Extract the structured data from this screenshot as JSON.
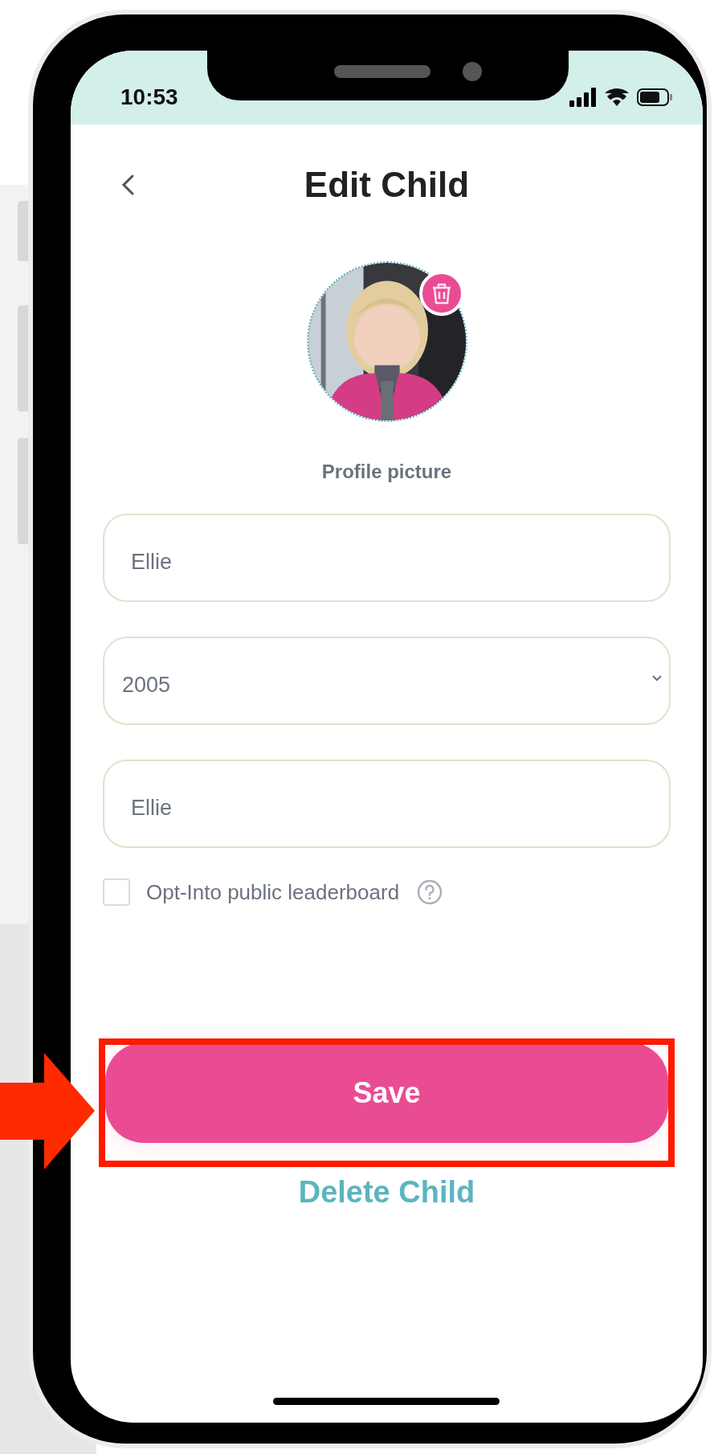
{
  "status_bar": {
    "time": "10:53"
  },
  "header": {
    "title": "Edit Child"
  },
  "profile": {
    "label": "Profile picture"
  },
  "fields": [
    {
      "kind": "text",
      "value": "Ellie"
    },
    {
      "kind": "select",
      "value": "2005"
    },
    {
      "kind": "text",
      "value": "Ellie"
    }
  ],
  "checkbox": {
    "label": "Opt-Into public leaderboard",
    "checked": false
  },
  "buttons": {
    "save": "Save",
    "delete": "Delete Child"
  }
}
